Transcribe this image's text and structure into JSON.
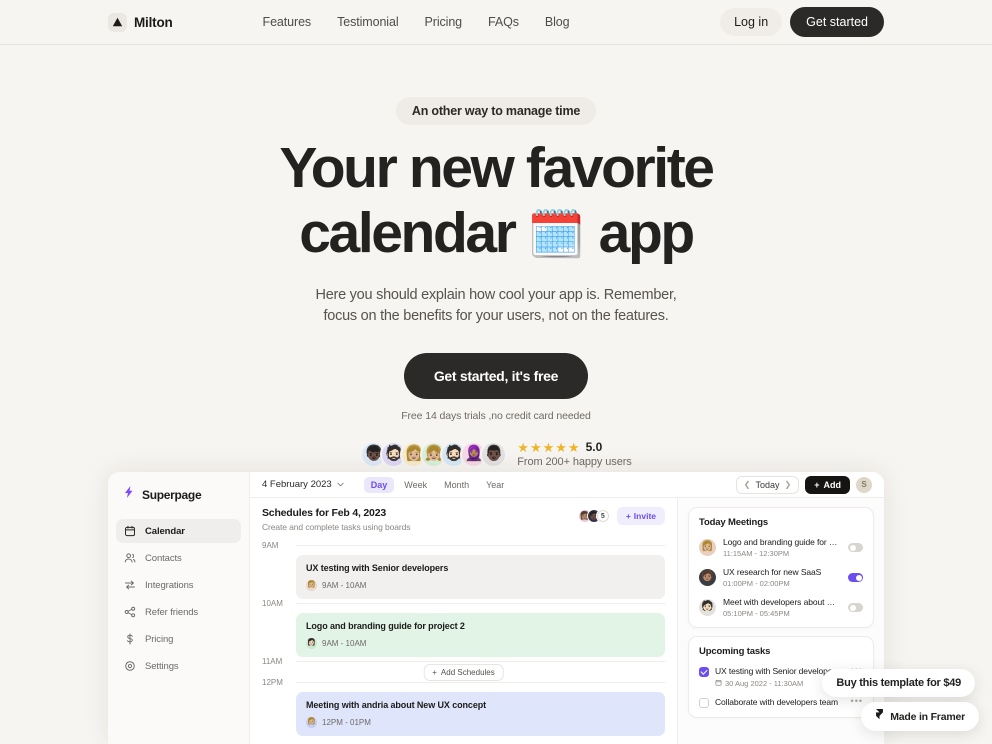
{
  "colors": {
    "page_bg": "#f7f5f1",
    "ink": "#232221",
    "dark_button": "#2b2a28",
    "accent_purple": "#6d4df0",
    "star_gold": "#f0b429",
    "event_grey": "#f1f0ee",
    "event_green": "#e2f4e6",
    "event_blue": "#dfe5fb"
  },
  "nav": {
    "brand": "Milton",
    "brand_icon": "triangle-logo-icon",
    "links": [
      {
        "label": "Features"
      },
      {
        "label": "Testimonial"
      },
      {
        "label": "Pricing"
      },
      {
        "label": "FAQs"
      },
      {
        "label": "Blog"
      }
    ],
    "login_label": "Log in",
    "get_started_label": "Get started"
  },
  "hero": {
    "eyebrow": "An other way to manage time",
    "title_line1": "Your new favorite",
    "title_line2_pre": "calendar ",
    "title_emoji": "🗓️",
    "title_line2_post": " app",
    "sub_line1": "Here you should explain how cool your app is. Remember,",
    "sub_line2": "focus on the benefits for your users, not on the features.",
    "cta_label": "Get started, it's free",
    "cta_note": "Free 14 days trials ,no credit card needed"
  },
  "social_proof": {
    "avatars": [
      {
        "bg": "#dce9f7",
        "glyph": "👦🏿"
      },
      {
        "bg": "#ded9f6",
        "glyph": "🧔🏻"
      },
      {
        "bg": "#f7eccd",
        "glyph": "👩🏼"
      },
      {
        "bg": "#d8efd9",
        "glyph": "👧🏼"
      },
      {
        "bg": "#d6eaf6",
        "glyph": "🧔🏻"
      },
      {
        "bg": "#f6d9e6",
        "glyph": "🧕🏽"
      },
      {
        "bg": "#e2e2e2",
        "glyph": "👨🏿"
      }
    ],
    "stars": [
      "★",
      "★",
      "★",
      "★",
      "★"
    ],
    "rating": "5.0",
    "caption": "From 200+ happy users"
  },
  "app": {
    "logo_name": "Superpage",
    "logo_icon": "lightning-bolt-icon",
    "sidebar": [
      {
        "label": "Calendar",
        "icon": "calendar-icon",
        "active": true
      },
      {
        "label": "Contacts",
        "icon": "contacts-icon",
        "active": false
      },
      {
        "label": "Integrations",
        "icon": "integrations-icon",
        "active": false
      },
      {
        "label": "Refer friends",
        "icon": "share-icon",
        "active": false
      },
      {
        "label": "Pricing",
        "icon": "dollar-icon",
        "active": false
      },
      {
        "label": "Settings",
        "icon": "gear-icon",
        "active": false
      }
    ],
    "topbar": {
      "date": "4 February 2023",
      "views": [
        {
          "label": "Day",
          "active": true
        },
        {
          "label": "Week",
          "active": false
        },
        {
          "label": "Month",
          "active": false
        },
        {
          "label": "Year",
          "active": false
        }
      ],
      "today_label": "Today",
      "add_label": "Add",
      "avatar_initial": "S"
    },
    "schedule": {
      "title": "Schedules for Feb 4, 2023",
      "subtitle": "Create and complete tasks using boards",
      "members": [
        {
          "bg": "#e7c9d8",
          "glyph": "👩🏽"
        },
        {
          "bg": "#3a2f4a",
          "glyph": "🧑🏿"
        }
      ],
      "member_count": "5",
      "invite_label": "Invite",
      "add_schedules_label": "Add Schedules",
      "slots": [
        {
          "time": "9AM",
          "event": {
            "title": "UX testing with Senior developers",
            "time": "9AM - 10AM",
            "bg": "#f1f0ee",
            "avatar_bg": "#e8d9c8",
            "avatar_glyph": "👩🏼"
          }
        },
        {
          "time": "10AM",
          "event": {
            "title": "Logo and branding guide for project 2",
            "time": "9AM - 10AM",
            "bg": "#e2f4e6",
            "avatar_bg": "#c9e8cf",
            "avatar_glyph": "👩🏻"
          }
        },
        {
          "time": "11AM",
          "event": null
        },
        {
          "time": "12PM",
          "event": {
            "title": "Meeting with andria about New UX concept",
            "time": "12PM - 01PM",
            "bg": "#dfe5fb",
            "avatar_bg": "#c4cdf4",
            "avatar_glyph": "👩🏼"
          }
        }
      ]
    },
    "today_meetings": {
      "title": "Today Meetings",
      "items": [
        {
          "title": "Logo and branding guide for UX..",
          "time": "11:15AM - 12:30PM",
          "toggle_on": false,
          "avatar_bg": "#e9cfc0",
          "avatar_glyph": "👩🏼"
        },
        {
          "title": "UX research for new SaaS",
          "time": "01:00PM - 02:00PM",
          "toggle_on": true,
          "avatar_bg": "#3b3b42",
          "avatar_glyph": "🧑🏽"
        },
        {
          "title": "Meet with developers about UI...",
          "time": "05:10PM - 05:45PM",
          "toggle_on": false,
          "avatar_bg": "#e3e1de",
          "avatar_glyph": "🧑🏻"
        }
      ]
    },
    "upcoming_tasks": {
      "title": "Upcoming tasks",
      "items": [
        {
          "title": "UX testing with Senior developer...",
          "date": "30 Aug 2022 - 11:30AM",
          "checked": true,
          "menu": "•••"
        },
        {
          "title": "Collaborate with developers team",
          "date": "",
          "checked": false,
          "menu": "•••"
        }
      ]
    }
  },
  "floating": {
    "buy_label": "Buy this template for $49",
    "framer_label": "Made in Framer",
    "framer_icon": "framer-logo-icon"
  }
}
